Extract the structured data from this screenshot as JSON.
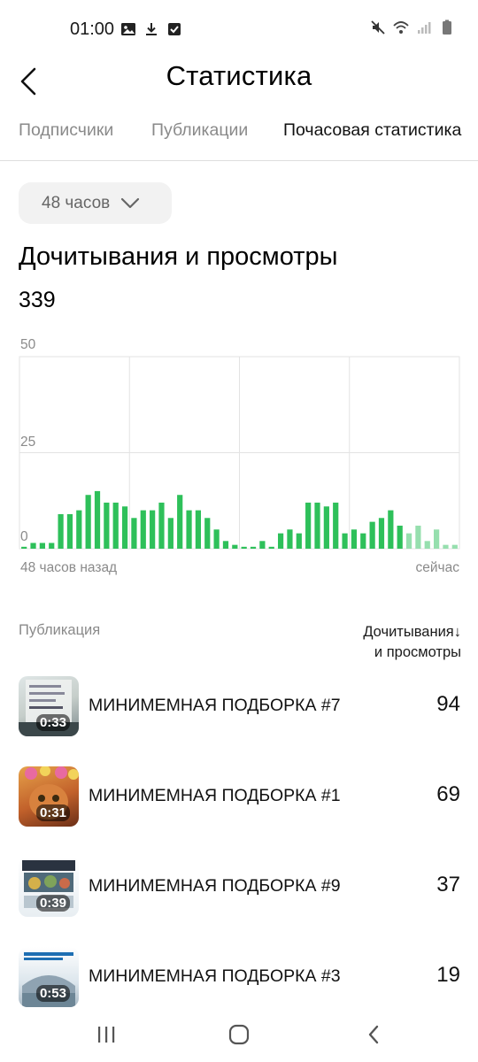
{
  "status_bar": {
    "time": "01:00",
    "left_icons": [
      "image-icon",
      "download-icon",
      "checkbox-icon"
    ],
    "right_icons": [
      "mute-icon",
      "wifi-icon",
      "signal-icon",
      "battery-icon"
    ]
  },
  "header": {
    "title": "Статистика",
    "back_icon": "back-arrow-icon"
  },
  "tabs": [
    {
      "label": "Подписчики",
      "active": false
    },
    {
      "label": "Публикации",
      "active": false
    },
    {
      "label": "Почасовая статистика",
      "active": true
    }
  ],
  "period": {
    "label": "48 часов",
    "icon": "chevron-down-icon"
  },
  "section": {
    "title": "Дочитывания и просмотры",
    "total": "339"
  },
  "chart_data": {
    "type": "bar",
    "title": "",
    "xlabel": "",
    "ylabel": "",
    "ylim": [
      0,
      50
    ],
    "y_ticks": [
      "50",
      "25",
      "0"
    ],
    "x_start_label": "48 часов назад",
    "x_end_label": "сейчас",
    "grid": true,
    "colors": {
      "bar": "#2ec05a",
      "bar_recent": "#96dfae",
      "grid": "#e3e3e3"
    },
    "values": [
      0.5,
      1.5,
      1.5,
      1.5,
      9,
      9,
      10,
      14,
      15,
      12,
      12,
      11,
      8,
      10,
      10,
      12,
      8,
      14,
      10,
      10,
      8,
      5,
      2,
      1,
      0.5,
      0.5,
      2,
      0.5,
      4,
      5,
      4,
      12,
      12,
      11,
      12,
      4,
      5,
      4,
      7,
      8,
      10,
      6,
      4,
      6,
      2,
      5,
      1,
      1
    ],
    "recent_count": 6
  },
  "list": {
    "col_publication": "Публикация",
    "col_views_line1": "Дочитывания↓",
    "col_views_line2": "и просмотры",
    "items": [
      {
        "title": "МИНИМЕМНАЯ ПОДБОРКА #7",
        "duration": "0:33",
        "value": "94",
        "thumb_color": "#7d8a8e"
      },
      {
        "title": "МИНИМЕМНАЯ ПОДБОРКА #1",
        "duration": "0:31",
        "value": "69",
        "thumb_color": "#c2612b"
      },
      {
        "title": "МИНИМЕМНАЯ ПОДБОРКА #9",
        "duration": "0:39",
        "value": "37",
        "thumb_color": "#4f6a7a"
      },
      {
        "title": "МИНИМЕМНАЯ ПОДБОРКА #3",
        "duration": "0:53",
        "value": "19",
        "thumb_color": "#a8b8c4"
      }
    ]
  },
  "nav_bar": {
    "icons": [
      "recent-apps-icon",
      "home-icon",
      "back-nav-icon"
    ]
  }
}
